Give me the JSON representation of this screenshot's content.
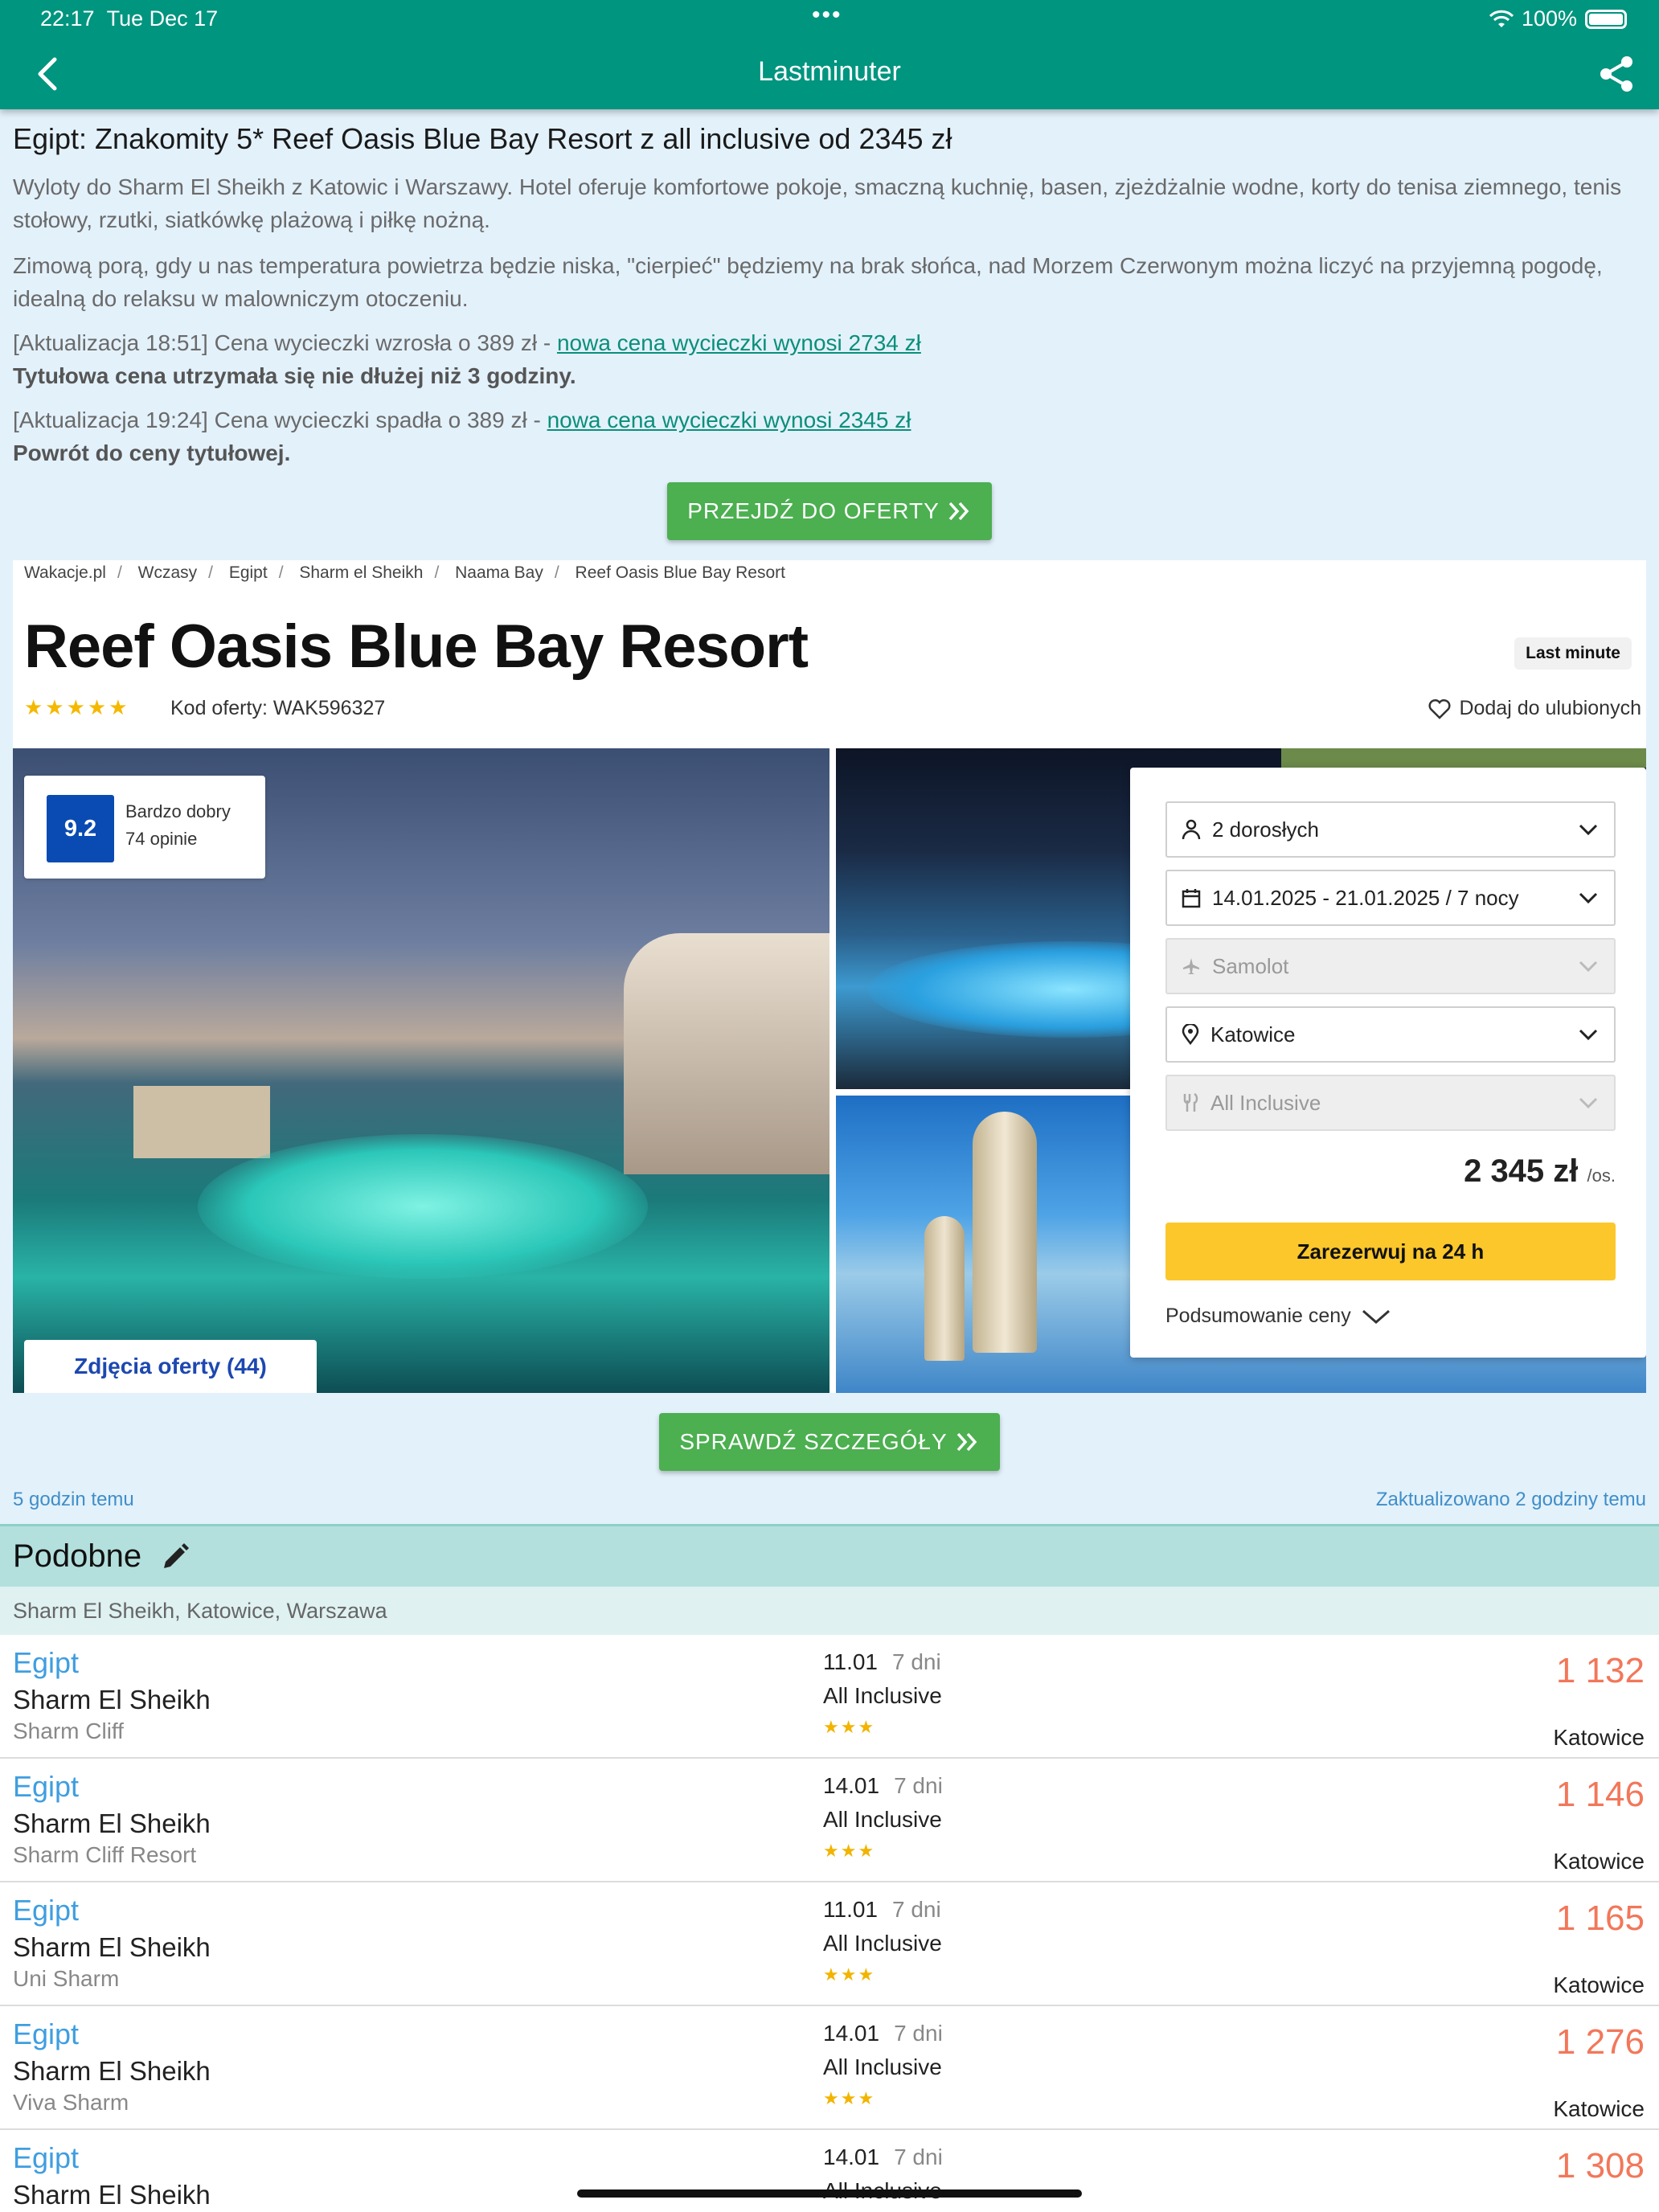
{
  "status_bar": {
    "time": "22:17",
    "date": "Tue Dec 17",
    "battery": "100%"
  },
  "nav": {
    "title": "Lastminuter"
  },
  "article": {
    "headline": "Egipt: Znakomity 5* Reef Oasis Blue Bay Resort z all inclusive od 2345 zł",
    "para1": "Wyloty do Sharm El Sheikh z Katowic i Warszawy. Hotel oferuje komfortowe pokoje, smaczną kuchnię, basen, zjeżdżalnie wodne, korty do tenisa ziemnego, tenis stołowy, rzutki, siatkówkę plażową i piłkę nożną.",
    "para2": "Zimową porą, gdy u nas temperatura powietrza będzie niska, \"cierpieć\" będziemy na brak słońca, nad Morzem Czerwonym można liczyć na przyjemną pogodę, idealną do relaksu w malowniczym otoczeniu.",
    "update1_prefix": "[Aktualizacja 18:51] Cena wycieczki wzrosła o 389 zł - ",
    "update1_link": "nowa cena wycieczki wynosi 2734 zł",
    "update1_bold": "Tytułowa cena utrzymała się nie dłużej niż 3 godziny.",
    "update2_prefix": "[Aktualizacja 19:24] Cena wycieczki spadła o 389 zł - ",
    "update2_link": "nowa cena wycieczki wynosi 2345 zł",
    "update2_bold": "Powrót do ceny tytułowej.",
    "cta_top": "PRZEJDŹ DO OFERTY",
    "cta_bottom": "SPRAWDŹ SZCZEGÓŁY"
  },
  "offer": {
    "breadcrumbs": [
      "Wakacje.pl",
      "Wczasy",
      "Egipt",
      "Sharm el Sheikh",
      "Naama Bay",
      "Reef Oasis Blue Bay Resort"
    ],
    "hotel_name": "Reef Oasis Blue Bay Resort",
    "badge": "Last minute",
    "stars": "★★★★★",
    "code": "Kod oferty: WAK596327",
    "favorite": "Dodaj do ulubionych",
    "rating_score": "9.2",
    "rating_label": "Bardzo dobry",
    "rating_count": "74 opinie",
    "photos_button": "Zdjęcia oferty (44)",
    "booking": {
      "adults": "2 dorosłych",
      "dates": "14.01.2025 - 21.01.2025 / 7 nocy",
      "transport": "Samolot",
      "departure": "Katowice",
      "board": "All Inclusive",
      "price": "2 345 zł",
      "price_unit": "/os.",
      "reserve": "Zarezerwuj na 24 h",
      "summary": "Podsumowanie ceny"
    }
  },
  "meta": {
    "posted": "5 godzin temu",
    "updated": "Zaktualizowano 2 godziny temu"
  },
  "similar": {
    "title": "Podobne",
    "filters": "Sharm El Sheikh, Katowice, Warszawa",
    "items": [
      {
        "country": "Egipt",
        "city": "Sharm El Sheikh",
        "hotel": "Sharm Cliff",
        "date": "11.01",
        "days": "7 dni",
        "board": "All Inclusive",
        "stars": "★★★",
        "price": "1 132",
        "from": "Katowice"
      },
      {
        "country": "Egipt",
        "city": "Sharm El Sheikh",
        "hotel": "Sharm Cliff Resort",
        "date": "14.01",
        "days": "7 dni",
        "board": "All Inclusive",
        "stars": "★★★",
        "price": "1 146",
        "from": "Katowice"
      },
      {
        "country": "Egipt",
        "city": "Sharm El Sheikh",
        "hotel": "Uni Sharm",
        "date": "11.01",
        "days": "7 dni",
        "board": "All Inclusive",
        "stars": "★★★",
        "price": "1 165",
        "from": "Katowice"
      },
      {
        "country": "Egipt",
        "city": "Sharm El Sheikh",
        "hotel": "Viva Sharm",
        "date": "14.01",
        "days": "7 dni",
        "board": "All Inclusive",
        "stars": "★★★",
        "price": "1 276",
        "from": "Katowice"
      },
      {
        "country": "Egipt",
        "city": "Sharm El Sheikh",
        "hotel": "",
        "date": "14.01",
        "days": "7 dni",
        "board": "All Inclusive",
        "stars": "",
        "price": "1 308",
        "from": ""
      }
    ]
  },
  "colors": {
    "bar": "#00957f",
    "accent_green": "#4caf50",
    "price": "#f2775a",
    "link_blue": "#3f9ee0",
    "reserve": "#fcc72b"
  },
  "icons": [
    "back-arrow-icon",
    "share-icon",
    "wifi-icon",
    "battery-icon",
    "double-chevron-right-icon",
    "heart-icon",
    "person-icon",
    "calendar-icon",
    "plane-icon",
    "location-pin-icon",
    "utensils-icon",
    "chevron-down-icon",
    "pencil-icon"
  ]
}
